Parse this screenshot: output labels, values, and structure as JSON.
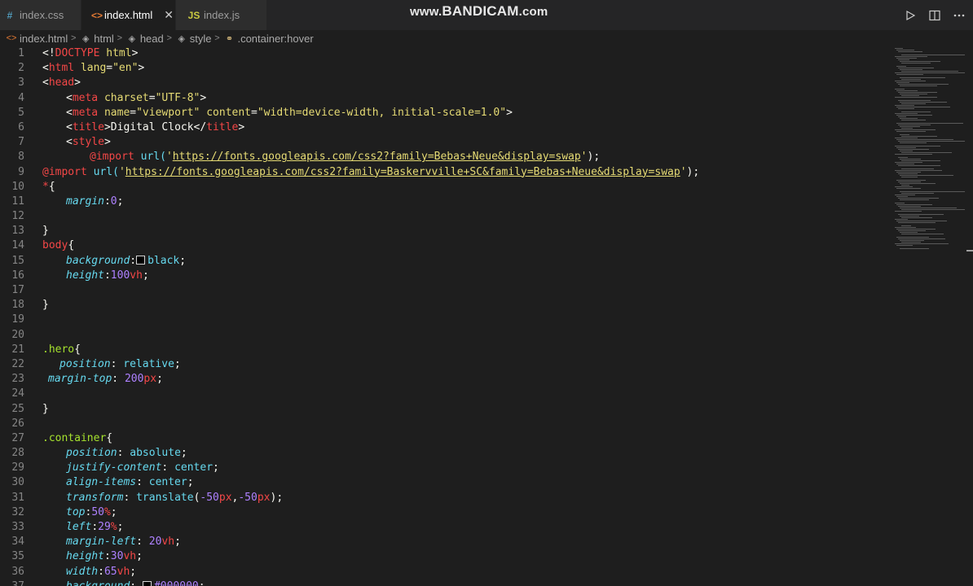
{
  "tabs": [
    {
      "icon": "#",
      "label": "index.css",
      "active": false
    },
    {
      "icon": "<>",
      "label": "index.html",
      "active": true,
      "close": "✕"
    },
    {
      "icon": "JS",
      "label": "index.js",
      "active": false
    }
  ],
  "watermark": {
    "prefix": "www.",
    "brand": "BANDICAM",
    "suffix": ".com"
  },
  "breadcrumb": [
    "index.html",
    "html",
    "head",
    "style",
    ".container:hover"
  ],
  "line_numbers": [
    "1",
    "2",
    "3",
    "4",
    "5",
    "6",
    "7",
    "8",
    "9",
    "10",
    "11",
    "12",
    "13",
    "14",
    "15",
    "16",
    "17",
    "18",
    "19",
    "20",
    "21",
    "22",
    "23",
    "24",
    "25",
    "26",
    "27",
    "28",
    "29",
    "30",
    "31",
    "32",
    "33",
    "34",
    "35",
    "36",
    "37"
  ],
  "code": {
    "l1": {
      "a": "<!",
      "b": "DOCTYPE",
      "c": " ",
      "d": "html",
      "e": ">"
    },
    "l2": {
      "a": "<",
      "b": "html",
      "c": " ",
      "d": "lang",
      "e": "=",
      "f": "\"en\"",
      "g": ">"
    },
    "l3": {
      "a": "<",
      "b": "head",
      "c": ">"
    },
    "l4": {
      "a": "<",
      "b": "meta",
      "c": " ",
      "d": "charset",
      "e": "=",
      "f": "\"UTF-8\"",
      "g": ">"
    },
    "l5": {
      "a": "<",
      "b": "meta",
      "c": " ",
      "d": "name",
      "e": "=",
      "f": "\"viewport\"",
      "g": " ",
      "h": "content",
      "i": "=",
      "j": "\"width=device-width, initial-scale=1.0\"",
      "k": ">"
    },
    "l6": {
      "a": "<",
      "b": "title",
      "c": ">",
      "d": "Digital Clock",
      "e": "</",
      "f": "title",
      "g": ">"
    },
    "l7": {
      "a": "<",
      "b": "style",
      "c": ">"
    },
    "l8": {
      "a": "@import",
      "b": " url(",
      "c": "'",
      "d": "https://fonts.googleapis.com/css2?family=Bebas+Neue&display=swap",
      "e": "'",
      "f": ");"
    },
    "l9": {
      "a": "@import",
      "b": " url(",
      "c": "'",
      "d": "https://fonts.googleapis.com/css2?family=Baskervville+SC&family=Bebas+Neue&display=swap",
      "e": "'",
      "f": ");"
    },
    "l10": {
      "a": "*",
      "b": "{"
    },
    "l11": {
      "a": "margin",
      "b": ":",
      "c": "0",
      "d": ";"
    },
    "l13": {
      "a": "}"
    },
    "l14": {
      "a": "body",
      "b": "{"
    },
    "l15": {
      "a": "background",
      "b": ":",
      "c": "black",
      "d": ";"
    },
    "l16": {
      "a": "height",
      "b": ":",
      "c": "100",
      "d": "vh",
      "e": ";"
    },
    "l18": {
      "a": "}"
    },
    "l21": {
      "a": ".hero",
      "b": "{"
    },
    "l22": {
      "a": "position",
      "b": ": ",
      "c": "relative",
      "d": ";"
    },
    "l23": {
      "a": "margin-top",
      "b": ": ",
      "c": "200",
      "d": "px",
      "e": ";"
    },
    "l25": {
      "a": "}"
    },
    "l27": {
      "a": ".container",
      "b": "{"
    },
    "l28": {
      "a": "position",
      "b": ": ",
      "c": "absolute",
      "d": ";"
    },
    "l29": {
      "a": "justify-content",
      "b": ": ",
      "c": "center",
      "d": ";"
    },
    "l30": {
      "a": "align-items",
      "b": ": ",
      "c": "center",
      "d": ";"
    },
    "l31": {
      "a": "transform",
      "b": ": ",
      "c": "translate",
      "d": "(",
      "e": "-50",
      "f": "px",
      "g": ",",
      "h": "-50",
      "i": "px",
      "j": ");"
    },
    "l32": {
      "a": "top",
      "b": ":",
      "c": "50",
      "d": "%",
      "e": ";"
    },
    "l33": {
      "a": "left",
      "b": ":",
      "c": "29",
      "d": "%",
      "e": ";"
    },
    "l34": {
      "a": "margin-left",
      "b": ": ",
      "c": "20",
      "d": "vh",
      "e": ";"
    },
    "l35": {
      "a": "height",
      "b": ":",
      "c": "30",
      "d": "vh",
      "e": ";"
    },
    "l36": {
      "a": "width",
      "b": ":",
      "c": "65",
      "d": "vh",
      "e": ";"
    },
    "l37": {
      "a": "background",
      "b": ": ",
      "c": "#000000",
      "d": ";"
    }
  },
  "colors": {
    "editor_bg": "#1e1e1e",
    "tag": "#f44747",
    "string": "#e6db74",
    "selector": "#a6e22e",
    "property": "#66d9ef",
    "number": "#ae81ff"
  }
}
